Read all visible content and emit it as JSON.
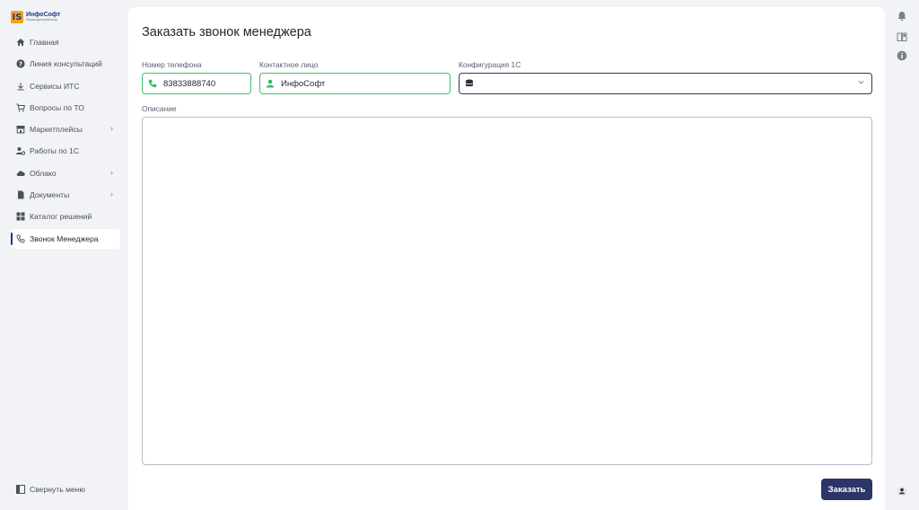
{
  "brand": {
    "name": "ИнфоСофт",
    "tagline": "Фирма-дистрибьютор",
    "mark": "IS",
    "colors": {
      "primary": "#1f3c88",
      "accent": "#f6a21a",
      "success": "#3cc46a",
      "button": "#2b3566"
    }
  },
  "sidebar": {
    "items": [
      {
        "label": "Главная",
        "icon": "home-icon",
        "chevron": false,
        "active": false
      },
      {
        "label": "Линия консультаций",
        "icon": "help-circle-icon",
        "chevron": false,
        "active": false
      },
      {
        "label": "Сервисы ИТС",
        "icon": "download-icon",
        "chevron": false,
        "active": false
      },
      {
        "label": "Вопросы по ТО",
        "icon": "cart-icon",
        "chevron": false,
        "active": false
      },
      {
        "label": "Маркетплейсы",
        "icon": "store-icon",
        "chevron": true,
        "active": false
      },
      {
        "label": "Работы по 1С",
        "icon": "user-gear-icon",
        "chevron": false,
        "active": false
      },
      {
        "label": "Облако",
        "icon": "cloud-icon",
        "chevron": true,
        "active": false
      },
      {
        "label": "Документы",
        "icon": "document-icon",
        "chevron": true,
        "active": false
      },
      {
        "label": "Каталог решений",
        "icon": "grid-icon",
        "chevron": false,
        "active": false
      },
      {
        "label": "Звонок Менеджера",
        "icon": "phone-icon",
        "chevron": false,
        "active": true
      }
    ],
    "collapse_label": "Свернуть меню"
  },
  "page": {
    "title": "Заказать звонок менеджера",
    "phone": {
      "label": "Номер телефона",
      "value": "83833888740"
    },
    "contact": {
      "label": "Контактное лицо",
      "value": "ИнфоСофт"
    },
    "config": {
      "label": "Конфигурация 1С",
      "value": ""
    },
    "description": {
      "label": "Описание",
      "value": ""
    },
    "submit_label": "Заказать"
  },
  "right_rail": {
    "icons": [
      "bell-icon",
      "book-icon",
      "info-icon",
      "user-icon"
    ]
  }
}
